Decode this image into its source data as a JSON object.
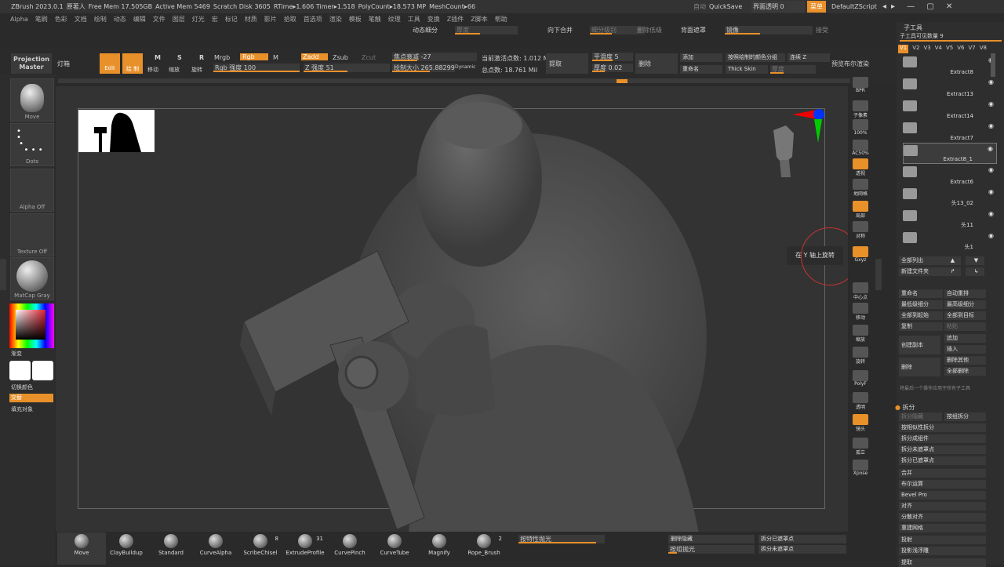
{
  "titlebar": {
    "app": "ZBrush 2023.0.1",
    "user": "原著人",
    "freemem": "Free Mem 17.505GB",
    "activemem": "Active Mem 5469",
    "scratch": "Scratch Disk 3605",
    "rtime": "RTime▸1.606 Timer▸1.518",
    "polycount": "PolyCount▸18.573 MP",
    "meshcount": "MeshCount▸66",
    "auto": "自动",
    "quicksave": "QuickSave",
    "transparency": "界面透明 0",
    "menu": "菜单",
    "script": "DefaultZScript"
  },
  "menubar": [
    "Alpha",
    "笔刷",
    "色彩",
    "文档",
    "绘制",
    "动态",
    "编辑",
    "文件",
    "图层",
    "灯光",
    "宏",
    "标记",
    "材质",
    "影片",
    "拾取",
    "首选项",
    "渲染",
    "模板",
    "笔触",
    "纹理",
    "工具",
    "变换",
    "Z插件",
    "Z脚本",
    "帮助"
  ],
  "topstrip": {
    "dynsub": "动态细分",
    "smooth": "厚度",
    "merge_down": "向下合并",
    "subdiv_level": "细分级别",
    "del_lower": "删除低级",
    "back_mask": "背面遮罩",
    "mirror": "镜像",
    "accept": "接受"
  },
  "toolbar": {
    "projection": "Projection Master",
    "lightbox": "灯箱",
    "edit": "Edit",
    "draw": "绘 制",
    "move": "移动",
    "scale": "缩放",
    "rotate": "旋转",
    "mrgb": "Mrgb",
    "rgb": "Rgb",
    "m": "M",
    "rgb_intensity": "Rgb 强度 100",
    "zadd": "Zadd",
    "zsub": "Zsub",
    "zcut": "Zcut",
    "z_intensity": "Z 强度 51",
    "focal": "焦点衰减 -27",
    "draw_size": "绘制大小 265.88299",
    "dynamic": "Dynamic",
    "active_points": "当前激活点数: 1.012 Mil",
    "total_points": "总点数: 18.761 Mil",
    "extract": "提取",
    "smooth": "平滑度 5",
    "thickness": "厚度 0.02",
    "delete": "删除",
    "add": "添加",
    "rename": "重命名",
    "by_color": "按照绘制的颜色分组",
    "connect": "连续 Z",
    "thickskin": "Thick Skin",
    "thick2": "厚度",
    "preview_bool": "预览布尔渲染"
  },
  "left": {
    "move": "Move",
    "dots": "Dots",
    "alpha": "Alpha Off",
    "texture": "Texture Off",
    "matcap": "MatCap Gray",
    "gradient": "渐变",
    "switch": "切换颜色",
    "alternate": "交替",
    "fill": "填充对象"
  },
  "shelf": [
    "BPR",
    "子像素",
    "100%",
    "AC50%",
    "透视",
    "地网格",
    "局部",
    "对称",
    "Gxyz",
    "",
    "中心点",
    "移动",
    "缩放",
    "旋转",
    "PolyF",
    "透明",
    "镜头",
    "孤立",
    "Xpose"
  ],
  "viewport": {
    "tooltip": "在 Y 轴上旋转"
  },
  "right": {
    "title": "子工具",
    "visible_count": "子工具可见数量 9",
    "versions": [
      "V1",
      "V2",
      "V3",
      "V4",
      "V5",
      "V6",
      "V7",
      "V8"
    ],
    "subtools": [
      "Extract8",
      "Extract13",
      "Extract14",
      "Extract7",
      "Extract8_1",
      "Extract6",
      "头13_02",
      "头11",
      "头1"
    ],
    "list_all": "全部列出",
    "new_folder": "新建文件夹",
    "rename": "重命名",
    "auto_reorder": "自动重排",
    "lowest": "最低级细分",
    "highest": "最高级细分",
    "all_low": "全部到起始",
    "all_high": "全部到目标",
    "duplicate": "复制",
    "paste": "粘贴",
    "create_copy": "创建副本",
    "append": "追加",
    "insert": "插入",
    "del": "删除",
    "del_other": "删除其他",
    "del_all": "全部删除",
    "apply_last": "将最后一个操作应用于所有子工具",
    "split": "拆分",
    "split_hidden": "拆分隐藏",
    "split_groups": "按组拆分",
    "split_similar": "按相似性拆分",
    "split_parts": "拆分成组件",
    "split_unmasked": "拆分未遮罩点",
    "split_masked": "拆分已遮罩点",
    "merge": "合并",
    "boolean": "布尔运算",
    "remesh": "Bevel Pro",
    "align": "对齐",
    "distribute": "分散对齐",
    "remesh2": "重建网格",
    "project": "投射",
    "projectshallow": "投影浅浮雕",
    "extract": "提取"
  },
  "bottom": {
    "brushes": [
      {
        "n": "Move",
        "c": ""
      },
      {
        "n": "ClayBuildup",
        "c": ""
      },
      {
        "n": "Standard",
        "c": ""
      },
      {
        "n": "CurveAlpha",
        "c": ""
      },
      {
        "n": "ScribeChisel",
        "c": "8"
      },
      {
        "n": "ExtrudeProfile",
        "c": "31"
      },
      {
        "n": "CurvePinch",
        "c": ""
      },
      {
        "n": "CurveTube",
        "c": ""
      },
      {
        "n": "Magnify",
        "c": ""
      },
      {
        "n": "Rope_Brush",
        "c": "2"
      }
    ],
    "polish": "按特性抛光",
    "del_hidden": "删除隐藏",
    "polish_groups": "按组抛光",
    "split_masked": "拆分已遮罩点",
    "split_unmasked": "拆分未遮罩点"
  }
}
